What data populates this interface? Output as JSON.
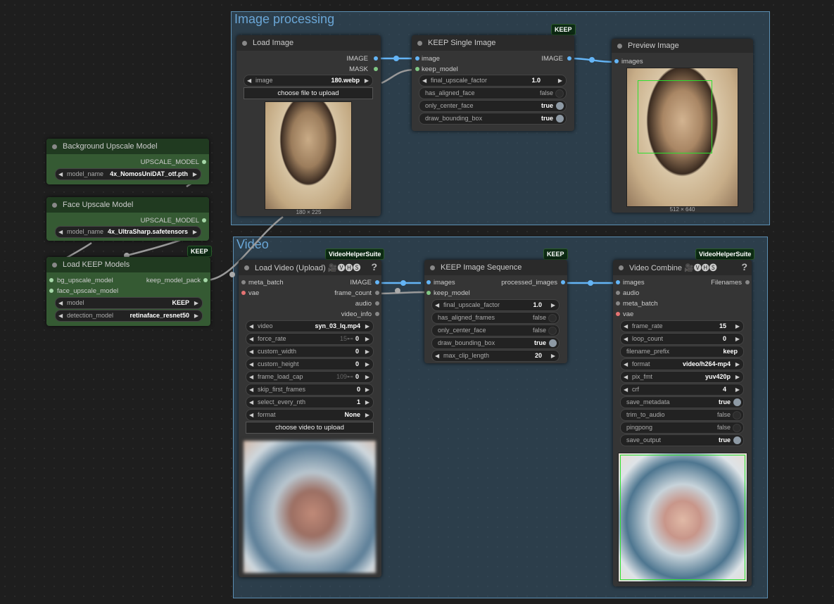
{
  "groups": {
    "image_processing": "Image processing",
    "video": "Video"
  },
  "badges": {
    "keep_single": "KEEP",
    "keep_models": "KEEP",
    "vhs_load": "VideoHelperSuite",
    "keep_seq": "KEEP",
    "vhs_combine": "VideoHelperSuite"
  },
  "load_image": {
    "title": "Load Image",
    "out_image": "IMAGE",
    "out_mask": "MASK",
    "image_label": "image",
    "image_value": "180.webp",
    "upload_button": "choose file to upload",
    "size": "180 × 225"
  },
  "keep_single": {
    "title": "KEEP Single Image",
    "in_image": "image",
    "in_model": "keep_model",
    "out_image": "IMAGE",
    "widgets": [
      {
        "label": "final_upscale_factor",
        "value": "1.0"
      },
      {
        "label": "has_aligned_face",
        "value": "false"
      },
      {
        "label": "only_center_face",
        "value": "true"
      },
      {
        "label": "draw_bounding_box",
        "value": "true"
      }
    ]
  },
  "preview": {
    "title": "Preview Image",
    "in_images": "images",
    "size": "512 × 640"
  },
  "bg_upscale": {
    "title": "Background Upscale Model",
    "out": "UPSCALE_MODEL",
    "label": "model_name",
    "value": "4x_NomosUniDAT_otf.pth"
  },
  "face_upscale": {
    "title": "Face Upscale Model",
    "out": "UPSCALE_MODEL",
    "label": "model_name",
    "value": "4x_UltraSharp.safetensors"
  },
  "keep_models": {
    "title": "Load KEEP Models",
    "in_bg": "bg_upscale_model",
    "in_face": "face_upscale_model",
    "out": "keep_model_pack",
    "model_label": "model",
    "model_value": "KEEP",
    "det_label": "detection_model",
    "det_value": "retinaface_resnet50"
  },
  "load_video": {
    "title": "Load Video (Upload) 🎥🅥🅗🅢",
    "help": "?",
    "in_meta": "meta_batch",
    "in_vae": "vae",
    "outs": [
      "IMAGE",
      "frame_count",
      "audio",
      "video_info"
    ],
    "widgets": [
      {
        "label": "video",
        "value": "syn_03_lq.mp4",
        "hint": ""
      },
      {
        "label": "force_rate",
        "value": "0",
        "hint": "15⊷"
      },
      {
        "label": "custom_width",
        "value": "0",
        "hint": ""
      },
      {
        "label": "custom_height",
        "value": "0",
        "hint": ""
      },
      {
        "label": "frame_load_cap",
        "value": "0",
        "hint": "109⊷"
      },
      {
        "label": "skip_first_frames",
        "value": "0",
        "hint": ""
      },
      {
        "label": "select_every_nth",
        "value": "1",
        "hint": ""
      },
      {
        "label": "format",
        "value": "None",
        "hint": ""
      }
    ],
    "upload_button": "choose video to upload"
  },
  "keep_seq": {
    "title": "KEEP Image Sequence",
    "in_images": "images",
    "in_model": "keep_model",
    "out": "processed_images",
    "widgets": [
      {
        "label": "final_upscale_factor",
        "value": "1.0"
      },
      {
        "label": "has_aligned_frames",
        "value": "false"
      },
      {
        "label": "only_center_face",
        "value": "false"
      },
      {
        "label": "draw_bounding_box",
        "value": "true"
      },
      {
        "label": "max_clip_length",
        "value": "20"
      }
    ]
  },
  "combine": {
    "title": "Video Combine 🎥🅥🅗🅢",
    "help": "?",
    "ins": [
      "images",
      "audio",
      "meta_batch",
      "vae"
    ],
    "out": "Filenames",
    "widgets": [
      {
        "label": "frame_rate",
        "value": "15"
      },
      {
        "label": "loop_count",
        "value": "0"
      },
      {
        "label": "filename_prefix",
        "value": "keep"
      },
      {
        "label": "format",
        "value": "video/h264-mp4"
      },
      {
        "label": "pix_fmt",
        "value": "yuv420p"
      },
      {
        "label": "crf",
        "value": "4"
      },
      {
        "label": "save_metadata",
        "value": "true"
      },
      {
        "label": "trim_to_audio",
        "value": "false"
      },
      {
        "label": "pingpong",
        "value": "false"
      },
      {
        "label": "save_output",
        "value": "true"
      }
    ]
  },
  "colors": {
    "image_link": "#64b5f6",
    "model_link": "#aaaaaa",
    "group_title": "#6aa6d6",
    "node_green": "#355a33"
  }
}
